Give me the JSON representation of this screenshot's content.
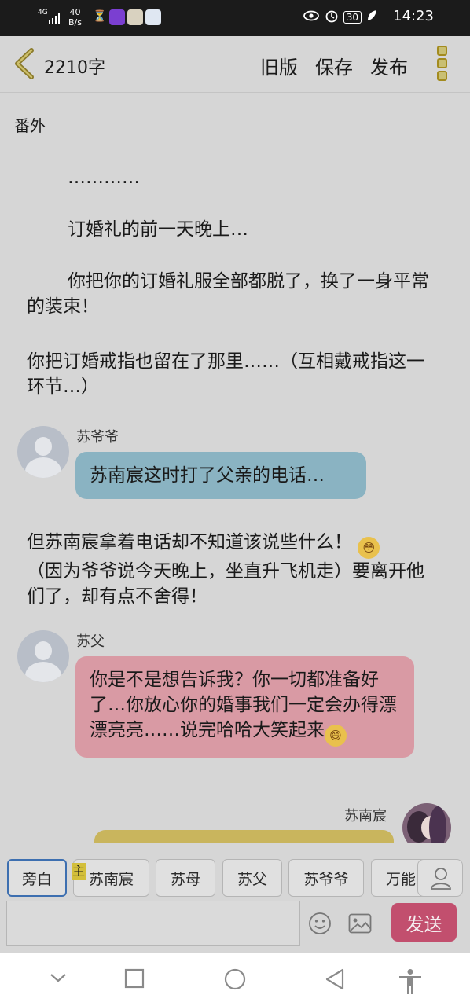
{
  "status_bar": {
    "signal_label": "4G",
    "net_speed_value": "40",
    "net_speed_unit": "B/s",
    "hourglass": "⏳",
    "battery": "30",
    "time": "14:23"
  },
  "header": {
    "word_count": "2210字",
    "old_version": "旧版",
    "save": "保存",
    "publish": "发布"
  },
  "content": {
    "section_title": "番外",
    "paragraphs": [
      "…………",
      "订婚礼的前一天晚上…",
      "你把你的订婚礼服全部都脱了，换了一身平常的装束！",
      "你把订婚戒指也留在了那里……（互相戴戒指这一环节…）"
    ],
    "messages": [
      {
        "speaker": "苏爷爷",
        "text": "苏南宸这时打了父亲的电话…"
      },
      {
        "speaker": "苏父",
        "text": "你是不是想告诉我？你一切都准备好了…你放心你的婚事我们一定会办得漂漂亮亮……说完哈哈大笑起来"
      },
      {
        "speaker": "苏南宸",
        "text": ""
      }
    ],
    "narration_2": "但苏南宸拿着电话却不知道该说些什么！",
    "narration_2b": "（因为爷爷说今天晚上，坐直升飞机走）要离开他们了，却有点不舍得！"
  },
  "roles": {
    "items": [
      "旁白",
      "苏南宸",
      "苏母",
      "苏父",
      "苏爷爷",
      "万能"
    ],
    "selected": "旁白",
    "main_mark": "主"
  },
  "composer": {
    "placeholder": "",
    "send": "发送"
  },
  "colors": {
    "blue_bubble": "#8ab3c2",
    "pink_bubble": "#d99aa4",
    "send_button": "#c24f6e"
  }
}
